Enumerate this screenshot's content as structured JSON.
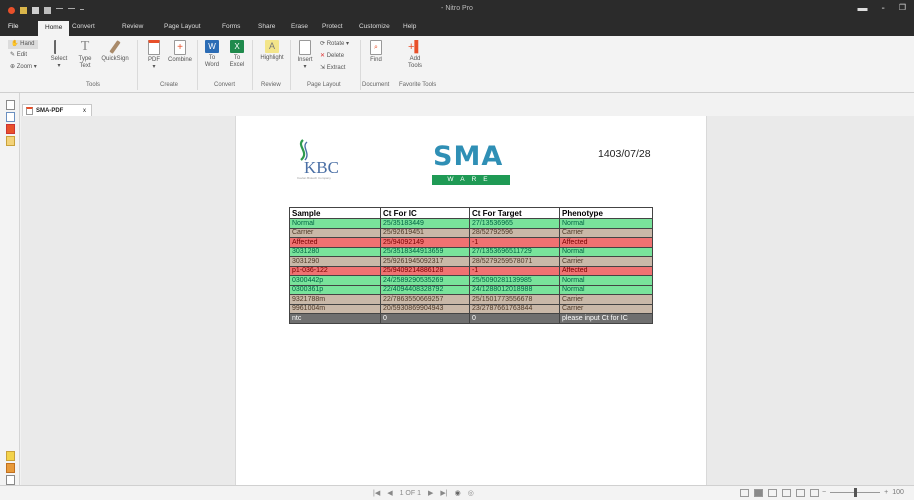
{
  "window": {
    "title": "- Nitro Pro"
  },
  "menu_tabs": [
    "File",
    "Home",
    "Convert",
    "Review",
    "Page Layout",
    "Forms",
    "Share",
    "Erase",
    "Protect",
    "Customize",
    "Help"
  ],
  "ribbon": {
    "hand": "Hand",
    "edit": "Edit",
    "zoom": "Zoom",
    "select": "Select",
    "type_text_1": "Type",
    "type_text_2": "Text",
    "quicksign": "QuickSign",
    "pdf": "PDF",
    "combine": "Combine",
    "to_word_1": "To",
    "to_word_2": "Word",
    "to_excel_1": "To",
    "to_excel_2": "Excel",
    "highlight": "Highlight",
    "insert": "Insert",
    "rotate": "Rotate",
    "delete": "Delete",
    "extract": "Extract",
    "find": "Find",
    "add_tools_1": "Add",
    "add_tools_2": "Tools",
    "groups": {
      "tools": "Tools",
      "create": "Create",
      "convert": "Convert",
      "review": "Review",
      "page_layout": "Page Layout",
      "document": "Document",
      "favorite": "Favorite Tools"
    }
  },
  "document_tab": {
    "name": "SMA-PDF",
    "close": "x"
  },
  "page": {
    "logo_left": "KBC",
    "logo_left_sub": "Kavian Biotech Company",
    "logo_title": "SMA",
    "logo_sub": "WARE",
    "date": "1403/07/28",
    "table": {
      "headers": [
        "Sample",
        "Ct For IC",
        "Ct For Target",
        "Phenotype"
      ],
      "rows": [
        {
          "type": "normal",
          "cells": [
            "Normal",
            "25/35183449",
            "27/13536965",
            "Normal"
          ]
        },
        {
          "type": "carrier",
          "cells": [
            "Carrier",
            "25/92619451",
            "28/52792596",
            "Carrier"
          ]
        },
        {
          "type": "affected",
          "cells": [
            "Affected",
            "25/94092149",
            "-1",
            "Affected"
          ]
        },
        {
          "type": "normal",
          "cells": [
            "3031280",
            "25/3518344913659",
            "27/1353696511729",
            "Normal"
          ]
        },
        {
          "type": "carrier",
          "cells": [
            "3031290",
            "25/9261945092317",
            "28/5279259578071",
            "Carrier"
          ]
        },
        {
          "type": "affected",
          "cells": [
            "p1-036-122",
            "25/9409214886128",
            "-1",
            "Affected"
          ]
        },
        {
          "type": "normal",
          "cells": [
            "0300442p",
            "24/2589290535269",
            "25/5090281139985",
            "Normal"
          ]
        },
        {
          "type": "normal",
          "cells": [
            "0300361p",
            "22/4094408328792",
            "24/1288012018988",
            "Normal"
          ]
        },
        {
          "type": "carrier",
          "cells": [
            "9321788m",
            "22/7863550669257",
            "25/1501773556678",
            "Carrier"
          ]
        },
        {
          "type": "carrier",
          "cells": [
            "9961004m",
            "20/5930869904943",
            "23/2787661763844",
            "Carrier"
          ]
        },
        {
          "type": "ntc",
          "cells": [
            "ntc",
            "0",
            "0",
            "please input Ct for IC"
          ]
        }
      ]
    }
  },
  "statusbar": {
    "page_indicator": "1 OF 1",
    "zoom_label": "100"
  },
  "colors": {
    "titlebar": "#2b2b2b",
    "normal": "#79e39b",
    "carrier": "#c9b8a8",
    "affected": "#f07272",
    "ntc": "#6f6f6f",
    "sma_blue": "#2f8fb5",
    "ware_green": "#1f9a55"
  }
}
